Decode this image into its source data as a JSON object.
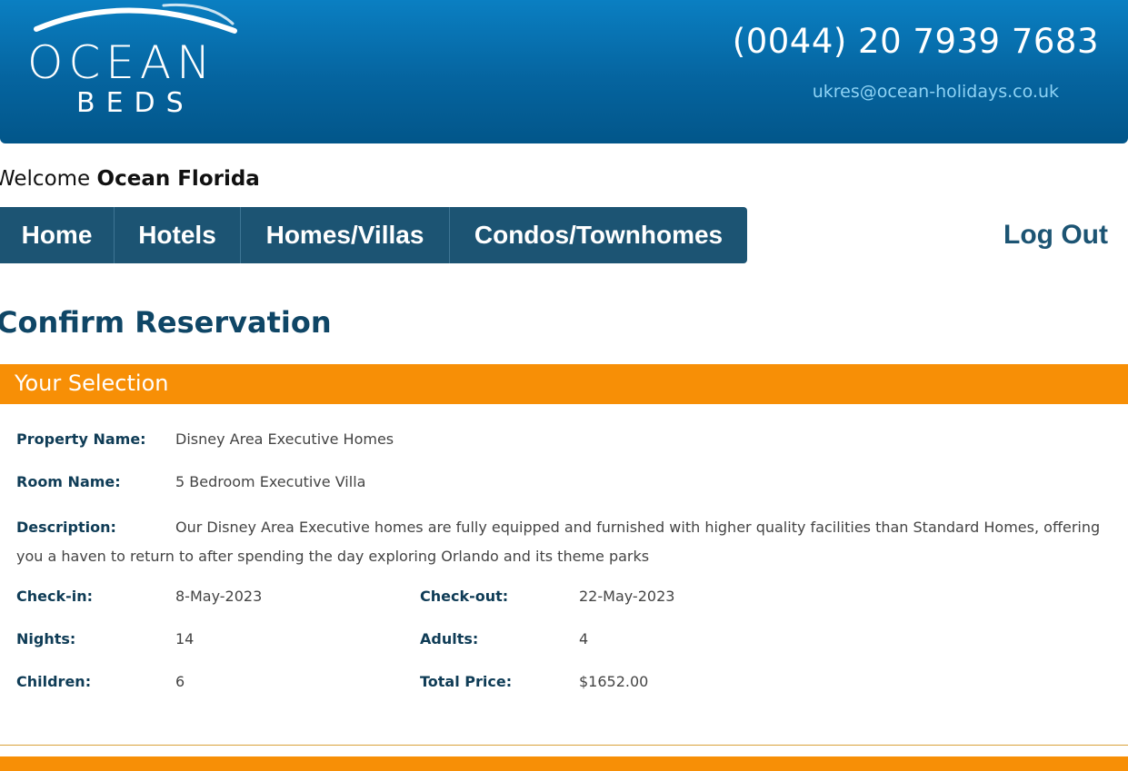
{
  "header": {
    "logo_word": "OCEAN",
    "logo_sub": "BEDS",
    "phone": "(0044) 20 7939 7683",
    "email": "ukres@ocean-holidays.co.uk"
  },
  "welcome": {
    "prefix": "Welcome",
    "name": "Ocean Florida"
  },
  "nav": {
    "items": [
      "Home",
      "Hotels",
      "Homes/Villas",
      "Condos/Townhomes"
    ],
    "logout": "Log Out"
  },
  "page_title": "Confirm Reservation",
  "selection": {
    "heading": "Your Selection",
    "property_label": "Property Name:",
    "property_value": "Disney Area Executive Homes",
    "room_label": "Room Name:",
    "room_value": "5 Bedroom Executive Villa",
    "description_label": "Description:",
    "description_value": "Our Disney Area Executive homes are fully equipped and furnished with higher quality facilities than Standard Homes, offering you a haven to return to after spending the day exploring Orlando and its theme parks",
    "checkin_label": "Check-in:",
    "checkin_value": "8-May-2023",
    "checkout_label": "Check-out:",
    "checkout_value": "22-May-2023",
    "nights_label": "Nights:",
    "nights_value": "14",
    "adults_label": "Adults:",
    "adults_value": "4",
    "children_label": "Children:",
    "children_value": "6",
    "price_label": "Total Price:",
    "price_value": "$1652.00"
  },
  "colors": {
    "header_blue": "#05649f",
    "nav_blue": "#1c5473",
    "accent_orange": "#f78f06",
    "label_navy": "#0f3c56"
  }
}
